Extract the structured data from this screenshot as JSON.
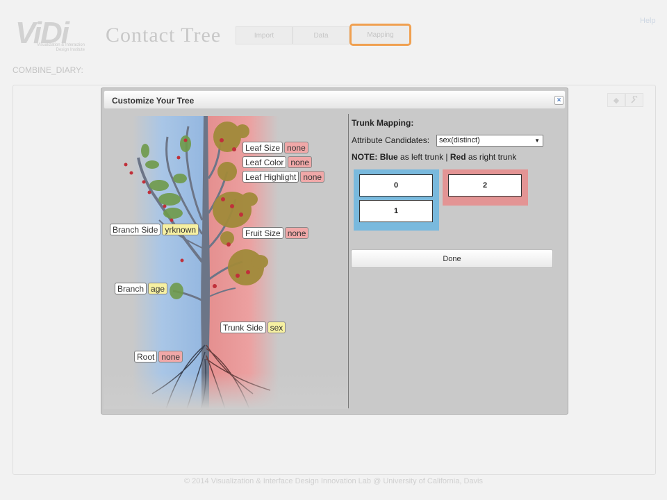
{
  "header": {
    "logo_text": "ViDi",
    "logo_subtitle": "Visualization & Interaction Design Institute",
    "app_title": "Contact Tree",
    "tabs": [
      {
        "label": "Import",
        "active": false
      },
      {
        "label": "Data",
        "active": false
      },
      {
        "label": "Mapping",
        "active": true
      }
    ],
    "help_label": "Help"
  },
  "dataset_label": "COMBINE_DIARY:",
  "panel_icons": [
    "diamond-icon",
    "wrench-icon"
  ],
  "dialog": {
    "title": "Customize Your Tree",
    "close_symbol": "×",
    "mappings": {
      "leaf_size": {
        "name": "Leaf Size",
        "value": "none"
      },
      "leaf_color": {
        "name": "Leaf Color",
        "value": "none"
      },
      "leaf_highlight": {
        "name": "Leaf Highlight",
        "value": "none"
      },
      "branch_side": {
        "name": "Branch Side",
        "value": "yrknown"
      },
      "fruit_size": {
        "name": "Fruit Size",
        "value": "none"
      },
      "branch": {
        "name": "Branch",
        "value": "age"
      },
      "trunk_side": {
        "name": "Trunk Side",
        "value": "sex"
      },
      "root": {
        "name": "Root",
        "value": "none"
      }
    },
    "right_panel": {
      "title": "Trunk Mapping:",
      "attr_label": "Attribute Candidates:",
      "attr_selected": "sex(distinct)",
      "note_prefix": "NOTE:",
      "note_blue": "Blue",
      "note_mid": "as left trunk |",
      "note_red": "Red",
      "note_suffix": "as right trunk",
      "left_values": [
        "0",
        "1"
      ],
      "right_values": [
        "2"
      ],
      "done_label": "Done"
    },
    "colors": {
      "left_trunk": "#79b9dd",
      "right_trunk": "#e39494",
      "value_red": "#f0a8a8",
      "value_yellow": "#f6f0a2"
    }
  },
  "footer": "© 2014 Visualization & Interface Design Innovation Lab @ University of California, Davis"
}
